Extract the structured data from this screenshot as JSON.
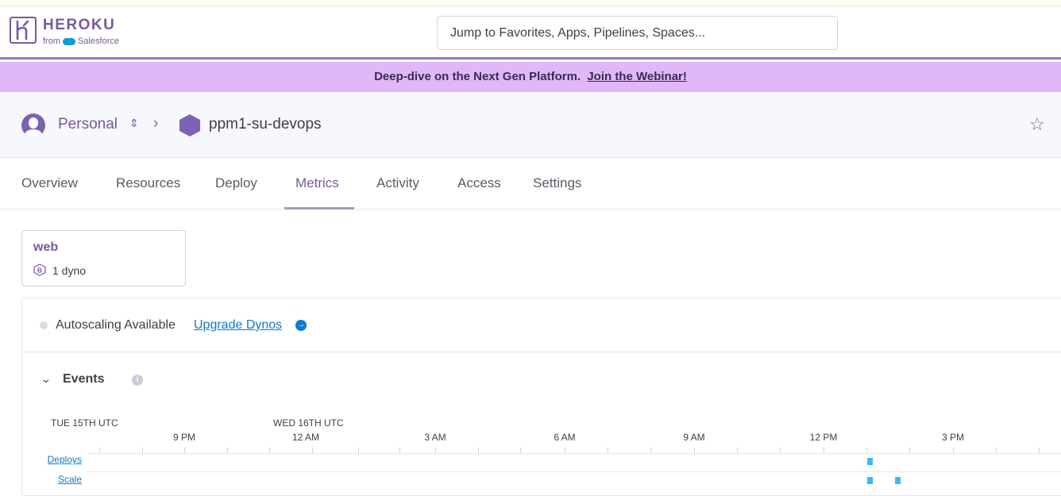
{
  "header": {
    "brand": "HEROKU",
    "brand_sub": "from",
    "brand_sub_company": "Salesforce",
    "search_placeholder": "Jump to Favorites, Apps, Pipelines, Spaces..."
  },
  "banner": {
    "text": "Deep-dive on the Next Gen Platform.",
    "link": "Join the Webinar!"
  },
  "breadcrumb": {
    "account": "Personal",
    "app": "ppm1-su-devops"
  },
  "tabs": [
    {
      "label": "Overview"
    },
    {
      "label": "Resources"
    },
    {
      "label": "Deploy"
    },
    {
      "label": "Metrics",
      "active": true
    },
    {
      "label": "Activity"
    },
    {
      "label": "Access"
    },
    {
      "label": "Settings"
    }
  ],
  "dyno": {
    "name": "web",
    "badge": "B",
    "count": "1 dyno"
  },
  "autoscaling": {
    "label": "Autoscaling Available",
    "link": "Upgrade Dynos"
  },
  "events": {
    "title": "Events",
    "dates": [
      "TUE 15TH UTC",
      "WED 16TH UTC"
    ],
    "ticks": [
      "9 PM",
      "12 AM",
      "3 AM",
      "6 AM",
      "9 AM",
      "12 PM",
      "3 PM"
    ],
    "rows": [
      "Deploys",
      "Scale"
    ]
  },
  "colors": {
    "brand": "#79589f",
    "banner": "#e0b8f8",
    "link": "#0e7ad1",
    "event": "#3db6f2"
  }
}
